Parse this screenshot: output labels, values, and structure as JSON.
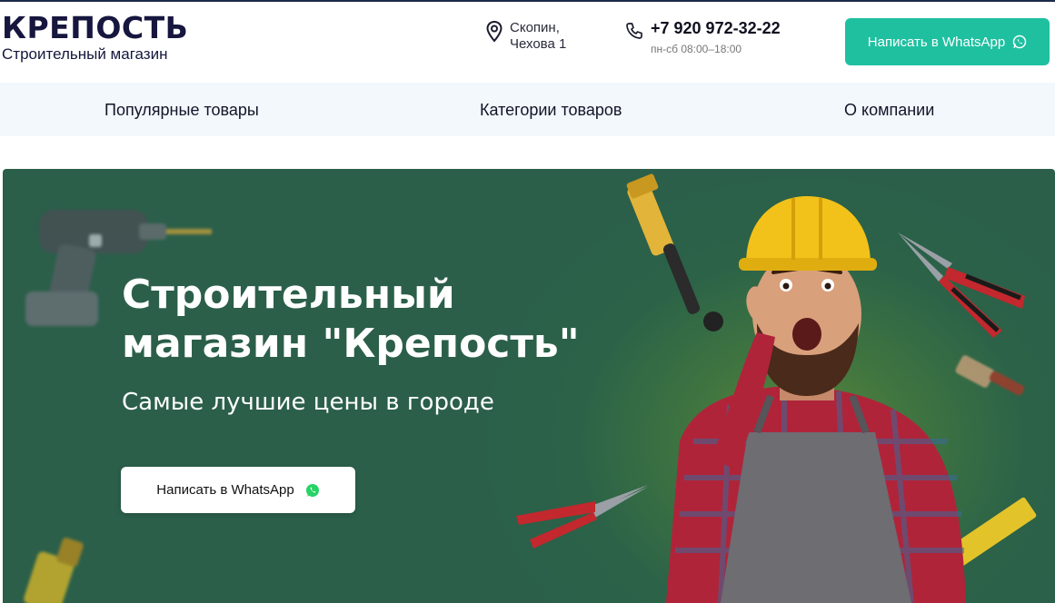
{
  "header": {
    "logo_title": "КРЕПОСТЬ",
    "logo_subtitle": "Строительный магазин",
    "address_line1": "Скопин,",
    "address_line2": "Чехова 1",
    "phone": "+7 920 972-32-22",
    "hours": "пн-сб 08:00–18:00",
    "whatsapp_label": "Написать в WhatsApp"
  },
  "nav": {
    "items": [
      {
        "label": "Популярные товары"
      },
      {
        "label": "Категории товаров"
      },
      {
        "label": "О компании"
      }
    ]
  },
  "hero": {
    "title_line1": "Строительный",
    "title_line2": "магазин \"Крепость\"",
    "subtitle": "Самые лучшие цены в городе",
    "whatsapp_label": "Написать в WhatsApp"
  },
  "colors": {
    "accent": "#1fc0a0",
    "hero_bg": "#2b6248",
    "whatsapp_green": "#25d366",
    "logo": "#16163f"
  },
  "icons": [
    "map-pin-icon",
    "phone-icon",
    "whatsapp-icon"
  ]
}
